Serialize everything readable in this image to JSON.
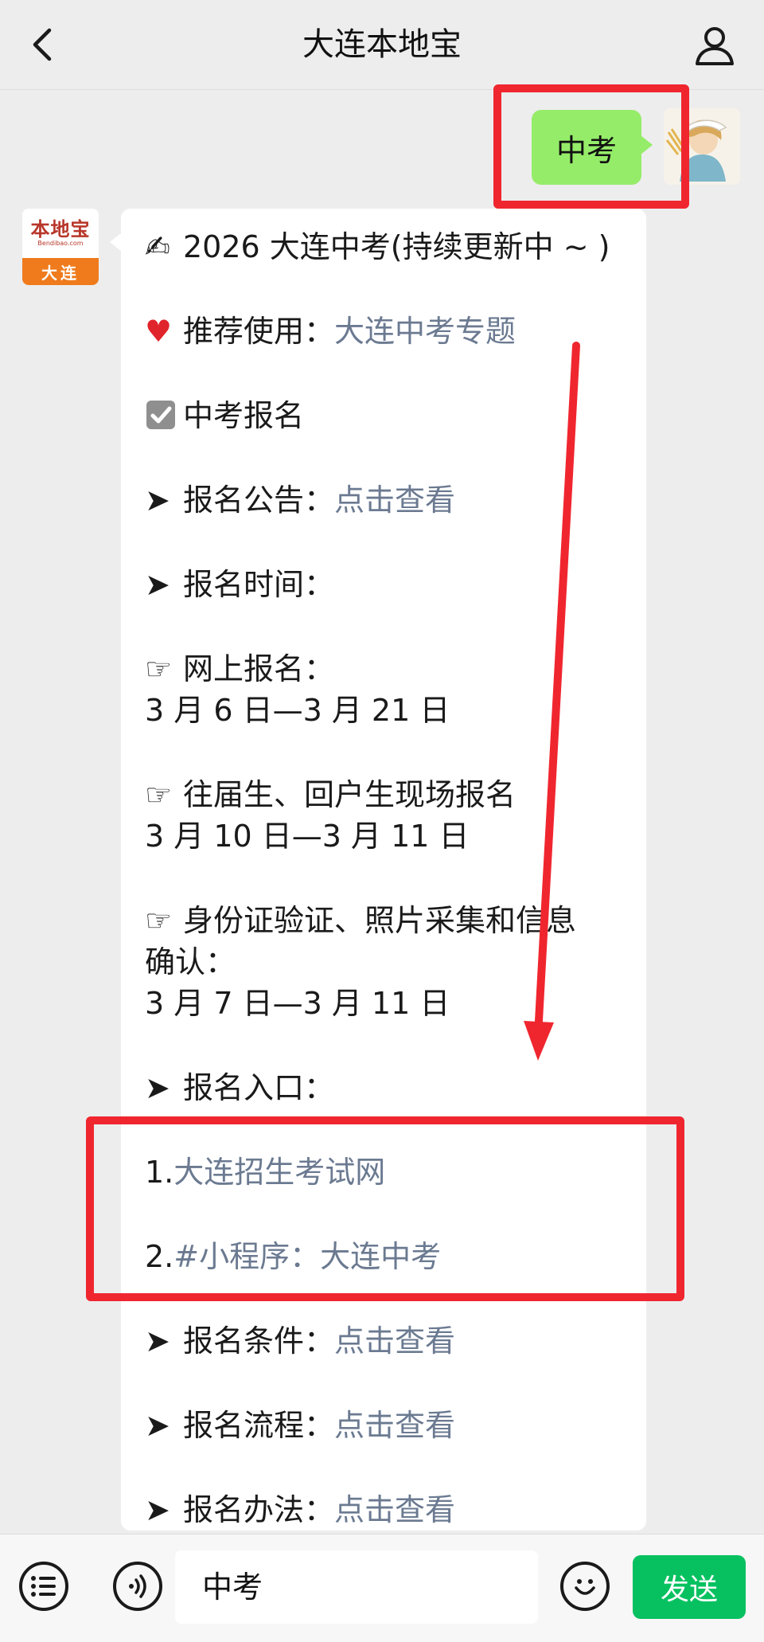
{
  "header": {
    "title": "大连本地宝",
    "back_icon": "chevron-left-icon",
    "profile_icon": "user-icon"
  },
  "user_message": {
    "text": "中考"
  },
  "bot": {
    "avatar": {
      "brand": "本地宝",
      "domain": "Bendibao.com",
      "city": "大连"
    },
    "lines": [
      {
        "prefix": "✍",
        "text": "2026 大连中考(持续更新中 ~ )",
        "link": ""
      },
      {
        "prefix": "❤️",
        "text": "推荐使用：",
        "link": "大连中考专题"
      },
      {
        "prefix": "☑️",
        "text": "中考报名",
        "link": ""
      },
      {
        "prefix": "➤",
        "text": "报名公告：",
        "link": "点击查看"
      },
      {
        "prefix": "➤",
        "text": "报名时间：",
        "link": ""
      },
      {
        "prefix": "☞",
        "text": "网上报名：",
        "link": ""
      },
      {
        "prefix": "",
        "text": "3 月 6 日—3 月 21 日",
        "link": ""
      },
      {
        "prefix": "☞",
        "text": "往届生、回户生现场报名",
        "link": ""
      },
      {
        "prefix": "",
        "text": "3 月 10 日—3 月 11 日",
        "link": ""
      },
      {
        "prefix": "☞",
        "text": "身份证验证、照片采集和信息",
        "link": ""
      },
      {
        "prefix": "",
        "text": "确认：",
        "link": ""
      },
      {
        "prefix": "",
        "text": "3 月 7 日—3 月 11 日",
        "link": ""
      },
      {
        "prefix": "➤",
        "text": "报名入口：",
        "link": ""
      },
      {
        "prefix": "",
        "text": "1.",
        "link": "大连招生考试网"
      },
      {
        "prefix": "",
        "text": "2.",
        "link": "#小程序：大连中考"
      },
      {
        "prefix": "➤",
        "text": "报名条件：",
        "link": "点击查看"
      },
      {
        "prefix": "➤",
        "text": "报名流程：",
        "link": "点击查看"
      },
      {
        "prefix": "➤",
        "text": "报名办法：",
        "link": "点击查看"
      }
    ]
  },
  "input_bar": {
    "menu_icon": "list-icon",
    "voice_icon": "voice-icon",
    "input_value": "中考",
    "emoji_icon": "emoji-icon",
    "send_label": "发送"
  },
  "colors": {
    "accent_green": "#07c160",
    "bubble_green": "#95ec69",
    "link": "#6b7a91",
    "annotation": "#f0262f"
  }
}
